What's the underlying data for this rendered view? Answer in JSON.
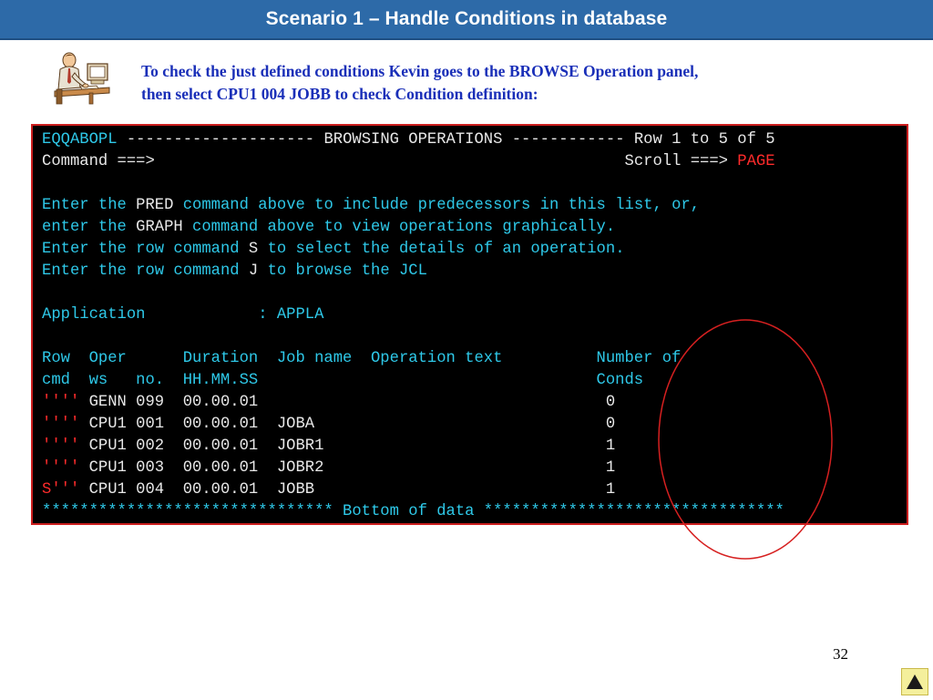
{
  "slide": {
    "title": "Scenario 1 – Handle Conditions in database",
    "intro_line1": "To check the just defined conditions Kevin goes to the BROWSE Operation panel,",
    "intro_line2": "then select CPU1 004 JOBB to check Condition definition:",
    "page_number": "32",
    "nav_icon": "up-triangle-icon"
  },
  "terminal": {
    "panel_id": "EQQABOPL",
    "header_dashes_left": " -------------------- ",
    "header_title": "BROWSING OPERATIONS",
    "header_dashes_right": " ------------ ",
    "row_info": "Row 1 to 5 of 5",
    "command_label": "Command ===>",
    "scroll_gap": "                                                  ",
    "scroll_label": "Scroll ===> ",
    "scroll_value": "PAGE",
    "help1_a": "Enter the ",
    "help1_cmd": "PRED",
    "help1_b": " command above to include predecessors in this list, or,",
    "help2_a": "enter the ",
    "help2_cmd": "GRAPH",
    "help2_b": " command above to view operations graphically.",
    "help3_a": "Enter the row command ",
    "help3_cmd": "S",
    "help3_b": " to select the details of an operation.",
    "help4_a": "Enter the row command ",
    "help4_cmd": "J",
    "help4_b": " to browse the JCL",
    "app_label": "Application            : ",
    "app_value": "APPLA",
    "col_header1": "Row  Oper      Duration  Job name  Operation text          Number of",
    "col_header2": "cmd  ws   no.  HH.MM.SS                                    Conds",
    "rows": [
      {
        "cmd": "''''",
        "rest": " GENN 099  00.00.01                                     0"
      },
      {
        "cmd": "''''",
        "rest": " CPU1 001  00.00.01  JOBA                               0"
      },
      {
        "cmd": "''''",
        "rest": " CPU1 002  00.00.01  JOBR1                              1"
      },
      {
        "cmd": "''''",
        "rest": " CPU1 003  00.00.01  JOBR2                              1"
      },
      {
        "cmd": "S'''",
        "rest": " CPU1 004  00.00.01  JOBB                               1"
      }
    ],
    "footer": "******************************* Bottom of data ********************************"
  },
  "colors": {
    "title_bar": "#2d6aa8",
    "intro_text": "#1a2fb8",
    "terminal_cyan": "#2ec8e8",
    "terminal_white": "#e8e8e8",
    "terminal_red": "#ff2b2b",
    "annotation": "#d62020"
  }
}
